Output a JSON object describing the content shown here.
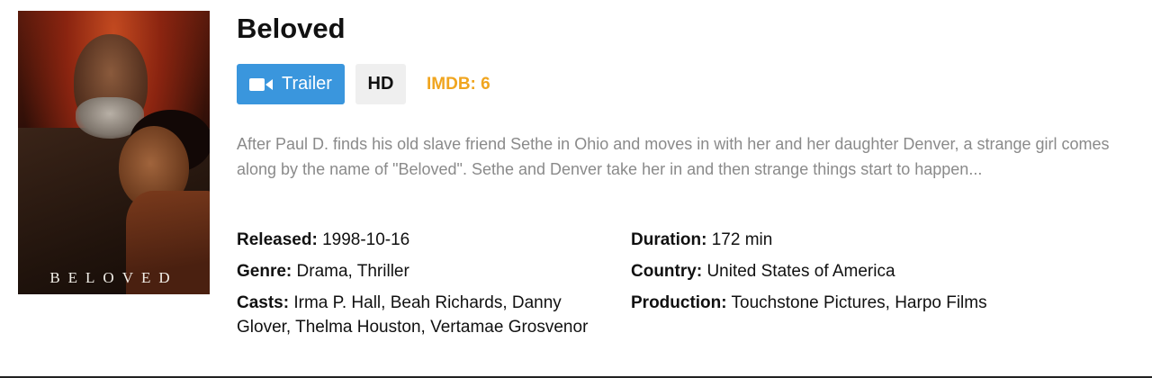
{
  "movie": {
    "title": "Beloved",
    "poster_title": "BELOVED",
    "trailer_label": "Trailer",
    "trailer_icon": "video-camera-icon",
    "quality_badge": "HD",
    "imdb_label": "IMDB:",
    "imdb_value": "6",
    "description": "After Paul D. finds his old slave friend Sethe in Ohio and moves in with her and her daughter Denver, a strange girl comes along by the name of \"Beloved\". Sethe and Denver take her in and then strange things start to happen...",
    "details_left": [
      {
        "key": "Released:",
        "value": "1998-10-16"
      },
      {
        "key": "Genre:",
        "value": "Drama, Thriller"
      },
      {
        "key": "Casts:",
        "value": "Irma P. Hall, Beah Richards, Danny Glover, Thelma Houston, Vertamae Grosvenor"
      }
    ],
    "details_right": [
      {
        "key": "Duration:",
        "value": "172 min"
      },
      {
        "key": "Country:",
        "value": "United States of America"
      },
      {
        "key": "Production:",
        "value": "Touchstone Pictures, Harpo Films"
      }
    ]
  },
  "colors": {
    "trailer_bg": "#3a96dd",
    "imdb": "#f0a51f",
    "description": "#8a8a8a",
    "hd_bg": "#efefef"
  }
}
